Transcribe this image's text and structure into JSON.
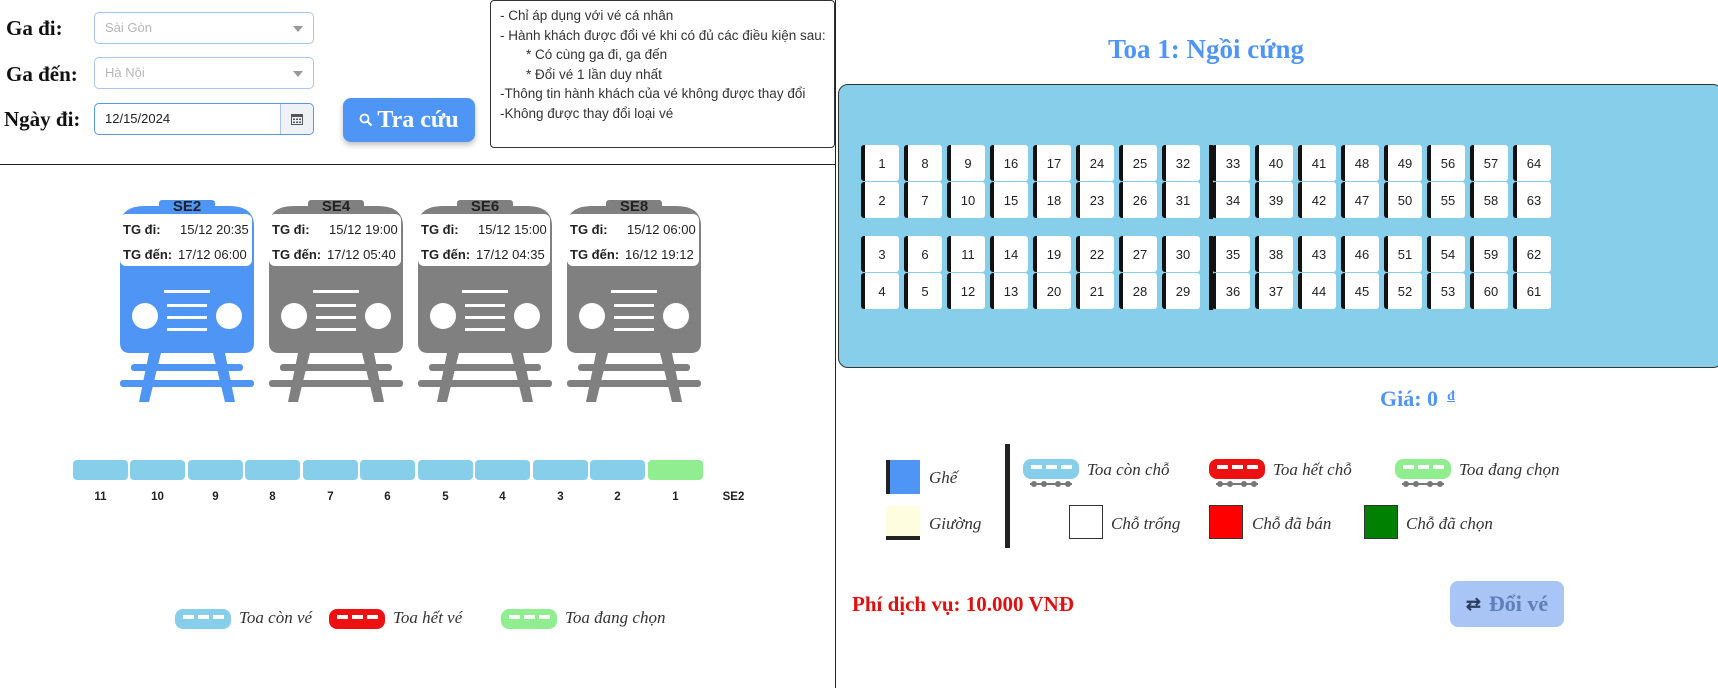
{
  "form": {
    "from_label": "Ga đi:",
    "from_value": "Sài Gòn",
    "to_label": "Ga đến:",
    "to_value": "Hà Nội",
    "date_label": "Ngày đi:",
    "date_value": "12/15/2024",
    "search_label": "Tra cứu"
  },
  "notes": [
    "- Chỉ áp dụng với vé cá nhân",
    "- Hành khách được đổi vé khi có đủ các điều kiện sau:",
    "* Có cùng ga đi, ga đến",
    "* Đổi vé 1 lần duy nhất",
    "-Thông tin hành khách của vé không được thay đổi",
    "-Không được thay đổi loại vé"
  ],
  "trains": [
    {
      "name": "SE2",
      "dep_label": "TG đi:",
      "dep": "15/12 20:35",
      "arr_label": "TG đến:",
      "arr": "17/12 06:00",
      "color": "#4f95f5",
      "selected": true
    },
    {
      "name": "SE4",
      "dep_label": "TG đi:",
      "dep": "15/12 19:00",
      "arr_label": "TG đến:",
      "arr": "17/12 05:40",
      "color": "#808080",
      "selected": false
    },
    {
      "name": "SE6",
      "dep_label": "TG đi:",
      "dep": "15/12 15:00",
      "arr_label": "TG đến:",
      "arr": "17/12 04:35",
      "color": "#808080",
      "selected": false
    },
    {
      "name": "SE8",
      "dep_label": "TG đi:",
      "dep": "15/12 06:00",
      "arr_label": "TG đến:",
      "arr": "16/12 19:12",
      "color": "#808080",
      "selected": false
    }
  ],
  "coaches": {
    "labels": [
      "11",
      "10",
      "9",
      "8",
      "7",
      "6",
      "5",
      "4",
      "3",
      "2",
      "1"
    ],
    "selected": "1",
    "train_label": "SE2",
    "available_color": "#87ceeb",
    "selected_color": "#90ee90"
  },
  "left_legend": {
    "available": "Toa còn vé",
    "full": "Toa hết vé",
    "selected": "Toa đang chọn"
  },
  "seatmap": {
    "title": "Toa 1: Ngồi cứng",
    "rows": [
      [
        "1",
        "8",
        "9",
        "16",
        "17",
        "24",
        "25",
        "32",
        "33",
        "40",
        "41",
        "48",
        "49",
        "56",
        "57",
        "64"
      ],
      [
        "2",
        "7",
        "10",
        "15",
        "18",
        "23",
        "26",
        "31",
        "34",
        "39",
        "42",
        "47",
        "50",
        "55",
        "58",
        "63"
      ],
      [
        "3",
        "6",
        "11",
        "14",
        "19",
        "22",
        "27",
        "30",
        "35",
        "38",
        "43",
        "46",
        "51",
        "54",
        "59",
        "62"
      ],
      [
        "4",
        "5",
        "12",
        "13",
        "20",
        "21",
        "28",
        "29",
        "36",
        "37",
        "44",
        "45",
        "52",
        "53",
        "60",
        "61"
      ]
    ],
    "price_label": "Giá: 0",
    "currency": "đ",
    "bg_color": "#87ceeb"
  },
  "right_legend": {
    "seat": "Ghế",
    "bed": "Giường",
    "available_coach": "Toa còn chỗ",
    "full_coach": "Toa hết chỗ",
    "selected_coach": "Toa đang chọn",
    "empty_seat": "Chỗ trống",
    "sold_seat": "Chỗ đã bán",
    "chosen_seat": "Chỗ đã chọn"
  },
  "fee_label": "Phí dịch vụ: 10.000 VNĐ",
  "exchange_label": "Đổi vé"
}
